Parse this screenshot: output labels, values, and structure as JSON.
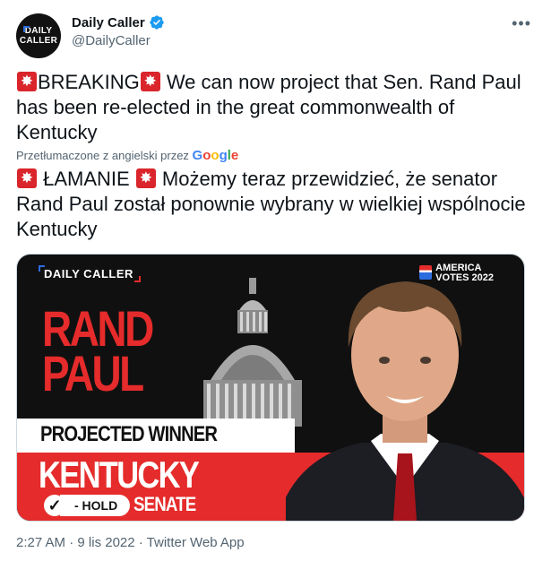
{
  "author": {
    "display_name": "Daily Caller",
    "handle": "@DailyCaller",
    "avatar_text_line1": "DAILY",
    "avatar_text_line2": "CALLER"
  },
  "menu_icon": "more-horizontal-icon",
  "tweet": {
    "text_breaking": "BREAKING",
    "text_body": " We can now project that Sen. Rand Paul has been re-elected in the great commonwealth of Kentucky",
    "translate_note": "Przetłumaczone z angielski przez",
    "translate_provider": "Google",
    "translated_breaking": " ŁAMANIE ",
    "translated_body": " Możemy teraz przewidzieć, że senator Rand Paul został ponownie wybrany w wielkiej wspólnocie Kentucky"
  },
  "card": {
    "brand": "DAILY CALLER",
    "america_votes_line1": "AMERICA",
    "america_votes_line2": "VOTES 2022",
    "candidate_first": "RAND",
    "candidate_last": "PAUL",
    "status": "PROJECTED WINNER",
    "state": "KENTUCKY",
    "hold": "- HOLD",
    "race": "SENATE"
  },
  "meta": {
    "time": "2:27 AM",
    "separator": " · ",
    "date": "9 lis 2022",
    "source": "Twitter Web App"
  },
  "colors": {
    "accent_red": "#e52b2b",
    "verified_blue": "#1d9bf0",
    "muted": "#536471"
  }
}
